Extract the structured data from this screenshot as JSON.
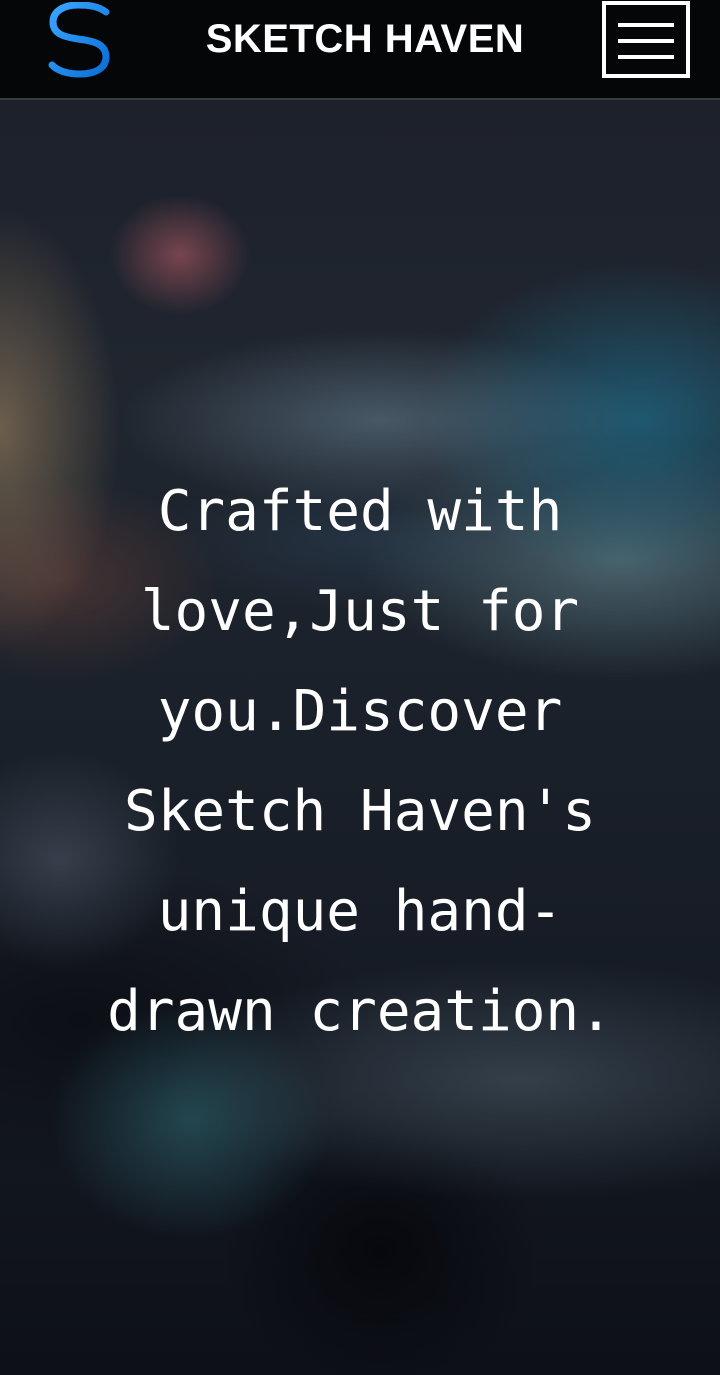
{
  "header": {
    "site_title": "SKETCH HAVEN",
    "logo_icon": "s-logo-icon",
    "menu_icon": "hamburger-menu-icon"
  },
  "hero": {
    "tagline": "Crafted with love,Just for you.Discover Sketch Haven's unique hand-drawn creation."
  },
  "colors": {
    "header_bg": "#050608",
    "logo_blue": "#1e8ff0",
    "text": "#ffffff"
  }
}
